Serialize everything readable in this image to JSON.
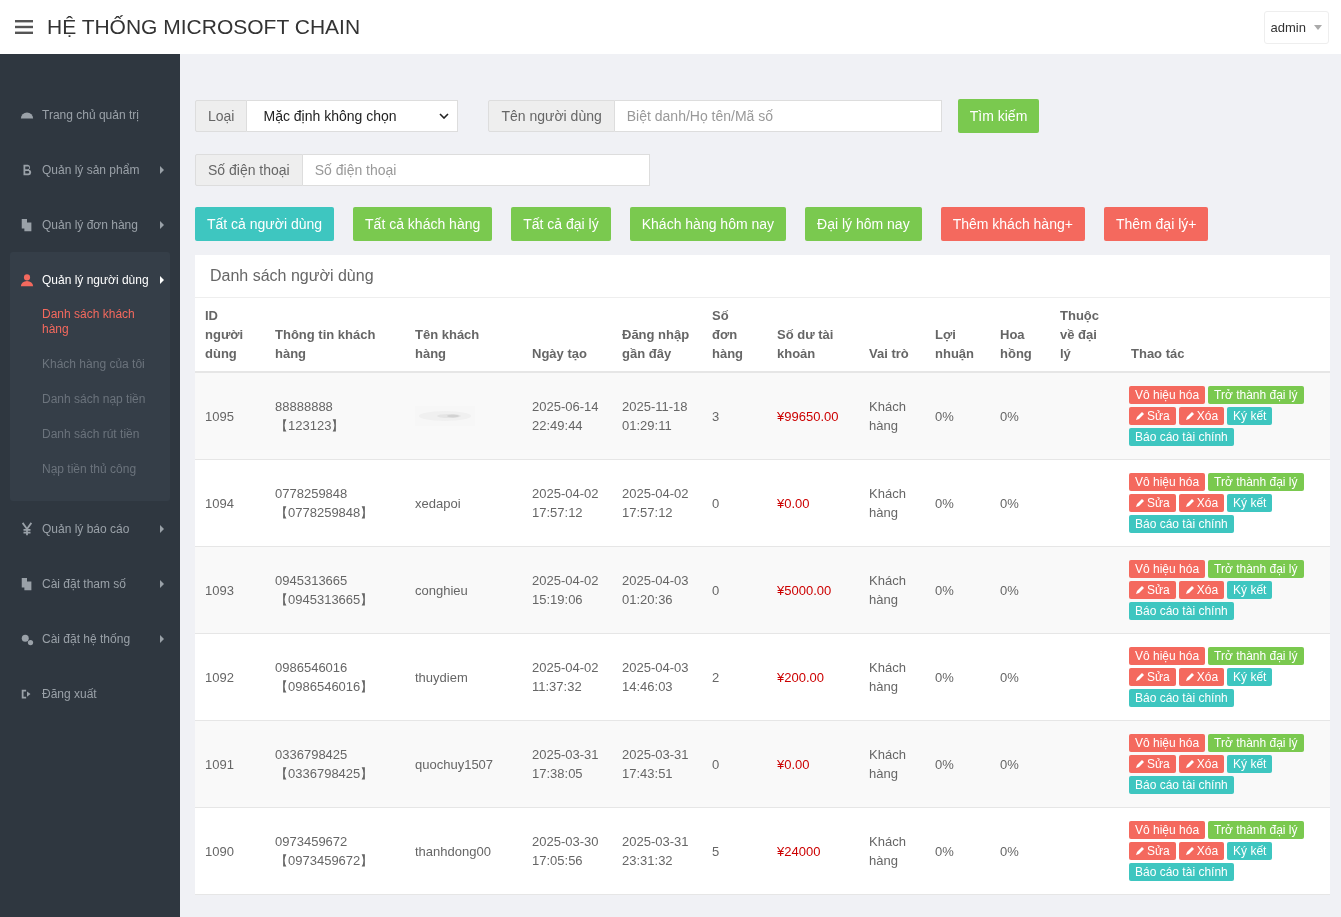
{
  "header": {
    "title": "HỆ THỐNG MICROSOFT CHAIN",
    "user": "admin"
  },
  "sidebar": {
    "items": [
      {
        "label": "Trang chủ quản trị",
        "kind": "link",
        "expanded": false
      },
      {
        "label": "Quản lý sản phẩm",
        "kind": "submenu",
        "expanded": false
      },
      {
        "label": "Quản lý đơn hàng",
        "kind": "submenu",
        "expanded": false
      },
      {
        "label": "Quản lý người dùng",
        "kind": "submenu",
        "expanded": true,
        "children": [
          {
            "label": "Danh sách khách hàng",
            "selected": true
          },
          {
            "label": "Khách hàng của tôi",
            "selected": false
          },
          {
            "label": "Danh sách nạp tiền",
            "selected": false
          },
          {
            "label": "Danh sách rút tiền",
            "selected": false
          },
          {
            "label": "Nạp tiền thủ công",
            "selected": false
          }
        ]
      },
      {
        "label": "Quản lý báo cáo",
        "kind": "submenu",
        "expanded": false
      },
      {
        "label": "Cài đặt tham số",
        "kind": "submenu",
        "expanded": false
      },
      {
        "label": "Cài đặt hệ thống",
        "kind": "submenu",
        "expanded": false
      },
      {
        "label": "Đăng xuất",
        "kind": "link",
        "expanded": false
      }
    ]
  },
  "filters": {
    "type_label": "Loại",
    "type_value": "Mặc định không chọn",
    "name_label": "Tên người dùng",
    "name_placeholder": "Biệt danh/Họ tên/Mã số",
    "search_button": "Tìm kiếm",
    "phone_label": "Số điện thoại",
    "phone_placeholder": "Số điện thoại"
  },
  "quick_buttons": [
    {
      "label": "Tất cả người dùng",
      "color": "#3ec6c0"
    },
    {
      "label": "Tất cả khách hàng",
      "color": "#7ac94f"
    },
    {
      "label": "Tất cả đại lý",
      "color": "#7ac94f"
    },
    {
      "label": "Khách hàng hôm nay",
      "color": "#7ac94f"
    },
    {
      "label": "Đại lý hôm nay",
      "color": "#7ac94f"
    },
    {
      "label": "Thêm khách hàng+",
      "color": "#f4695e"
    },
    {
      "label": "Thêm đại lý+",
      "color": "#f4695e"
    }
  ],
  "table": {
    "title": "Danh sách người dùng",
    "columns": [
      "ID người dùng",
      "Thông tin khách hàng",
      "Tên khách hàng",
      "Ngày tạo",
      "Đăng nhập gần đây",
      "Số đơn hàng",
      "Số dư tài khoản",
      "Vai trò",
      "Lợi nhuận",
      "Hoa hồng",
      "Thuộc về đại lý",
      "Thao tác"
    ],
    "rows": [
      {
        "id": "1095",
        "phone": "88888888",
        "code": "【123123】",
        "created": "2025-06-14 22:49:44",
        "login": "2025-11-18 01:29:11",
        "orders": "3",
        "balance": "¥99650.00",
        "role": "Khách hàng",
        "profit": "0%",
        "commission": "0%",
        "actions": [
          {
            "label": "Vô hiệu hóa",
            "kind": "danger"
          },
          {
            "label": "Trở thành đại lý",
            "kind": "success"
          },
          {
            "label": "Sửa",
            "kind": "edit"
          },
          {
            "label": "Xóa",
            "kind": "edit"
          },
          {
            "label": "Ký kết",
            "kind": "info"
          },
          {
            "label": "Báo cáo tài chính",
            "kind": "info"
          }
        ]
      },
      {
        "id": "1094",
        "phone": "0778259848",
        "code": "【0778259848】",
        "name": "xedapoi",
        "created": "2025-04-02 17:57:12",
        "login": "2025-04-02 17:57:12",
        "orders": "0",
        "balance": "¥0.00",
        "role": "Khách hàng",
        "profit": "0%",
        "commission": "0%",
        "actions": [
          {
            "label": "Vô hiệu hóa",
            "kind": "danger"
          },
          {
            "label": "Trở thành đại lý",
            "kind": "success"
          },
          {
            "label": "Sửa",
            "kind": "edit"
          },
          {
            "label": "Xóa",
            "kind": "edit"
          },
          {
            "label": "Ký kết",
            "kind": "info"
          },
          {
            "label": "Báo cáo tài chính",
            "kind": "info"
          }
        ]
      },
      {
        "id": "1093",
        "phone": "0945313665",
        "code": "【0945313665】",
        "name": "conghieu",
        "created": "2025-04-02 15:19:06",
        "login": "2025-04-03 01:20:36",
        "orders": "0",
        "balance": "¥5000.00",
        "role": "Khách hàng",
        "profit": "0%",
        "commission": "0%",
        "actions": [
          {
            "label": "Vô hiệu hóa",
            "kind": "danger"
          },
          {
            "label": "Trở thành đại lý",
            "kind": "success"
          },
          {
            "label": "Sửa",
            "kind": "edit"
          },
          {
            "label": "Xóa",
            "kind": "edit"
          },
          {
            "label": "Ký kết",
            "kind": "info"
          },
          {
            "label": "Báo cáo tài chính",
            "kind": "info"
          }
        ]
      },
      {
        "id": "1092",
        "phone": "0986546016",
        "code": "【0986546016】",
        "name": "thuydiem",
        "created": "2025-04-02 11:37:32",
        "login": "2025-04-03 14:46:03",
        "orders": "2",
        "balance": "¥200.00",
        "role": "Khách hàng",
        "profit": "0%",
        "commission": "0%",
        "actions": [
          {
            "label": "Vô hiệu hóa",
            "kind": "danger"
          },
          {
            "label": "Trở thành đại lý",
            "kind": "success"
          },
          {
            "label": "Sửa",
            "kind": "edit"
          },
          {
            "label": "Xóa",
            "kind": "edit"
          },
          {
            "label": "Ký kết",
            "kind": "info"
          },
          {
            "label": "Báo cáo tài chính",
            "kind": "info"
          }
        ]
      },
      {
        "id": "1091",
        "phone": "0336798425",
        "code": "【0336798425】",
        "name": "quochuy1507",
        "created": "2025-03-31 17:38:05",
        "login": "2025-03-31 17:43:51",
        "orders": "0",
        "balance": "¥0.00",
        "role": "Khách hàng",
        "profit": "0%",
        "commission": "0%",
        "actions": [
          {
            "label": "Vô hiệu hóa",
            "kind": "danger"
          },
          {
            "label": "Trở thành đại lý",
            "kind": "success"
          },
          {
            "label": "Sửa",
            "kind": "edit"
          },
          {
            "label": "Xóa",
            "kind": "edit"
          },
          {
            "label": "Ký kết",
            "kind": "info"
          },
          {
            "label": "Báo cáo tài chính",
            "kind": "info"
          }
        ]
      },
      {
        "id": "1090",
        "phone": "0973459672",
        "code": "【0973459672】",
        "name": "thanhdong00",
        "created": "2025-03-30 17:05:56",
        "login": "2025-03-31 23:31:32",
        "orders": "5",
        "balance": "¥24000",
        "role": "Khách hàng",
        "profit": "0%",
        "commission": "0%",
        "actions": [
          {
            "label": "Vô hiệu hóa",
            "kind": "danger"
          },
          {
            "label": "Trở thành đại lý",
            "kind": "success"
          },
          {
            "label": "Sửa",
            "kind": "edit"
          },
          {
            "label": "Xóa",
            "kind": "edit"
          },
          {
            "label": "Ký kết",
            "kind": "info"
          },
          {
            "label": "Báo cáo tài chính",
            "kind": "info"
          }
        ]
      }
    ]
  }
}
